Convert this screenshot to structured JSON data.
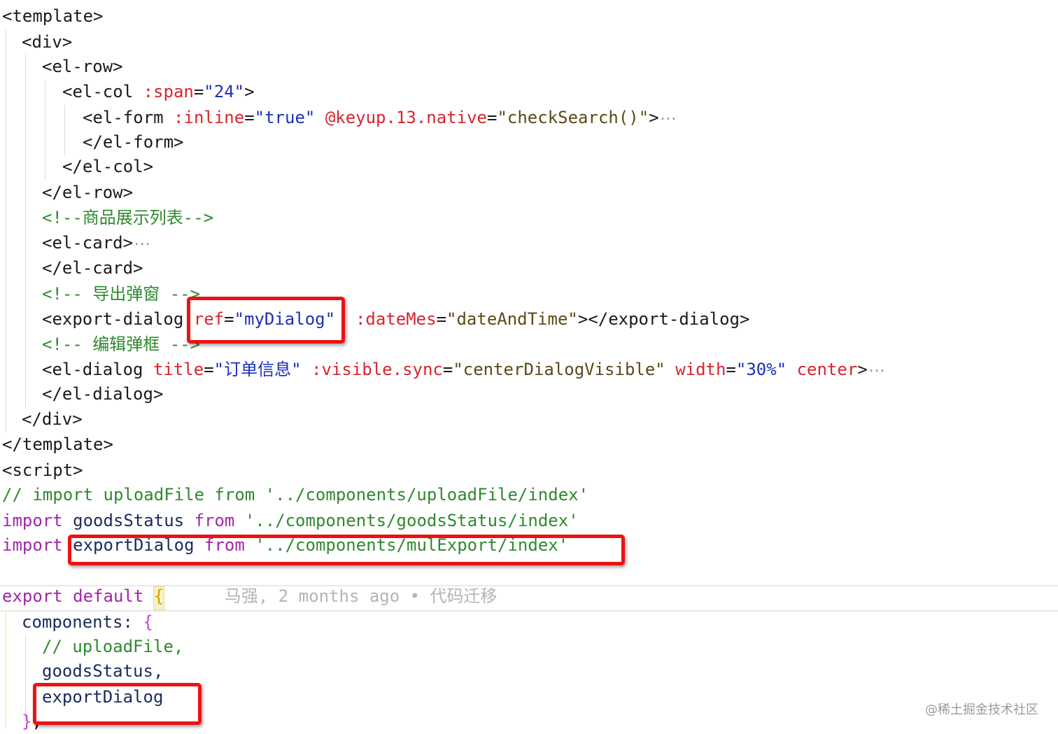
{
  "code": {
    "l01": "<template>",
    "l02": "<div>",
    "l03": "<el-row>",
    "l04": {
      "open": "<el-col ",
      "attr": ":span",
      "eq": "=",
      "val": "\"24\"",
      "close": ">"
    },
    "l05": {
      "open": "<el-form ",
      "attr1": ":inline",
      "eq1": "=",
      "val1": "\"true\"",
      "attr2": "@keyup.13.native",
      "eq2": "=",
      "val2": "\"checkSearch()\"",
      "close": ">",
      "fold": "···"
    },
    "l06": "</el-form>",
    "l07": "</el-col>",
    "l08": "</el-row>",
    "l09": "<!--商品展示列表-->",
    "l10": {
      "text": "<el-card>",
      "fold": "···"
    },
    "l11": "</el-card>",
    "l12": "<!-- 导出弹窗 -->",
    "l13": {
      "open": "<export-dialog ",
      "attr1": "ref",
      "eq1": "=",
      "val1": "\"myDialog\"",
      "attr2": ":dateMes",
      "eq2": "=",
      "val2": "\"dateAndTime\"",
      "close": "></export-dialog>"
    },
    "l14": "<!-- 编辑弹框 -->",
    "l15": {
      "open": "<el-dialog ",
      "attr1": "title",
      "eq1": "=",
      "val1": "\"订单信息\"",
      "attr2": ":visible.sync",
      "eq2": "=",
      "val2": "\"centerDialogVisible\"",
      "attr3": "width",
      "eq3": "=",
      "val3": "\"30%\"",
      "attr4": "center",
      "close": ">",
      "fold": "···"
    },
    "l16": "</el-dialog>",
    "l17": "</div>",
    "l18": "</template>",
    "l19": "<script>",
    "l20": "// import uploadFile from '../components/uploadFile/index'",
    "l21": {
      "kw1": "import",
      "id": "goodsStatus",
      "kw2": "from",
      "str": "'../components/goodsStatus/index'"
    },
    "l22": {
      "kw1": "import",
      "id": "exportDialog",
      "kw2": "from",
      "str": "'../components/mulExport/index'"
    },
    "l23": {
      "kw": "export default",
      "brace": "{",
      "blame": "马强, 2 months ago • 代码迁移"
    },
    "l24": {
      "key": "components:",
      "brace": "{"
    },
    "l25": "// uploadFile,",
    "l26": "goodsStatus,",
    "l27": "exportDialog",
    "l28": {
      "brace": "}",
      "comma": ","
    }
  },
  "watermark": "@稀土掘金技术社区",
  "colors": {
    "highlight_box": "#ee1111",
    "tag": "#1a1a1a",
    "attribute": "#d6262e",
    "string": "#1d2fb8",
    "comment": "#2e8a2e",
    "keyword": "#a226a8",
    "identifier": "#1a2b5c",
    "blame": "#b4b4b4"
  }
}
